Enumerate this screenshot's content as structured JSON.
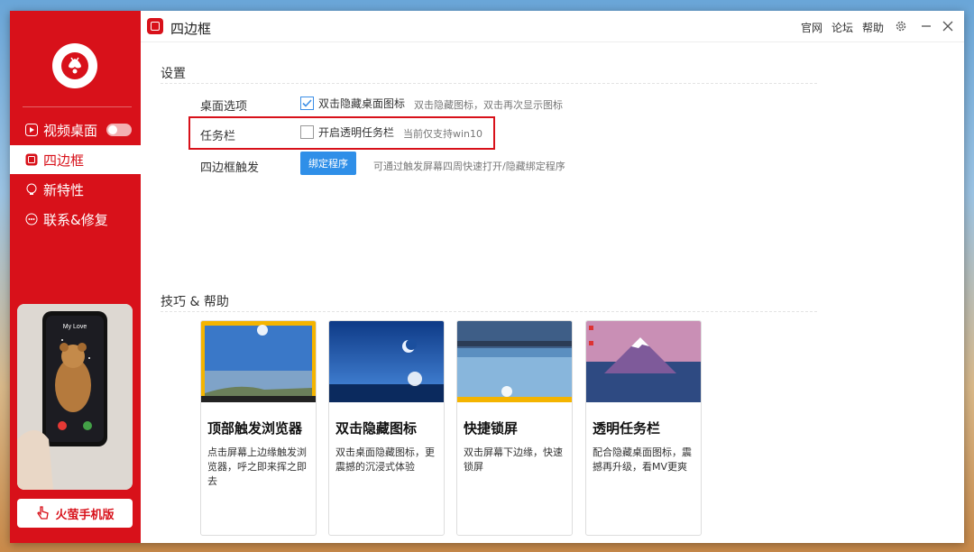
{
  "sidebar": {
    "items": [
      {
        "label": "视频桌面",
        "icon": "play-icon"
      },
      {
        "label": "四边框",
        "icon": "frame-icon"
      },
      {
        "label": "新特性",
        "icon": "bulb-icon"
      },
      {
        "label": "联系&修复",
        "icon": "chat-icon"
      }
    ],
    "video_toggle": "off",
    "phone_card_lock_text": "My Love",
    "mobile_button_label": "火萤手机版"
  },
  "titlebar": {
    "title": "四边框",
    "links": [
      "官网",
      "论坛",
      "帮助"
    ]
  },
  "settings": {
    "section_title": "设置",
    "desktop_label": "桌面选项",
    "desktop_checkbox_label": "双击隐藏桌面图标",
    "desktop_checkbox_checked": true,
    "desktop_hint": "双击隐藏图标，双击再次显示图标",
    "taskbar_label": "任务栏",
    "taskbar_checkbox_label": "开启透明任务栏",
    "taskbar_checkbox_checked": false,
    "taskbar_hint": "当前仅支持win10",
    "trigger_label": "四边框触发",
    "bind_button": "绑定程序",
    "trigger_hint": "可通过触发屏幕四周快速打开/隐藏绑定程序"
  },
  "tips": {
    "section_title": "技巧 & 帮助",
    "cards": [
      {
        "title": "顶部触发浏览器",
        "desc": "点击屏幕上边缘触发浏览器，呼之即来挥之即去"
      },
      {
        "title": "双击隐藏图标",
        "desc": "双击桌面隐藏图标，更震撼的沉浸式体验"
      },
      {
        "title": "快捷锁屏",
        "desc": "双击屏幕下边缘，快速锁屏"
      },
      {
        "title": "透明任务栏",
        "desc": "配合隐藏桌面图标，震撼再升级，看MV更爽"
      }
    ]
  },
  "colors": {
    "brand_red": "#d8111a",
    "accent_blue": "#2f8fe8"
  }
}
